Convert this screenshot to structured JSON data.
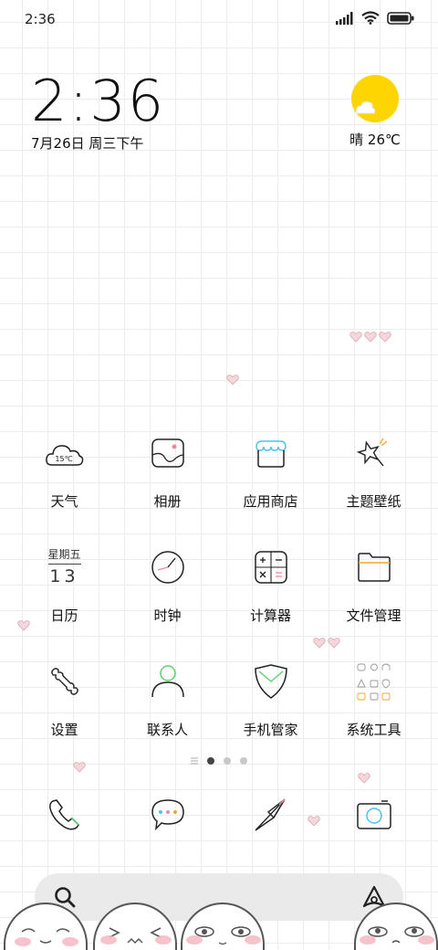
{
  "status_bar": {
    "time": "2:36",
    "icons": [
      "signal-icon",
      "wifi-icon",
      "battery-icon"
    ]
  },
  "clock_widget": {
    "time": "2:36",
    "date": "7月26日 周三下午"
  },
  "weather_widget": {
    "condition_icon": "sun-cloud-icon",
    "text": "晴 26℃"
  },
  "weather_app_icon_temp": "15℃",
  "calendar_icon": {
    "weekday": "星期五",
    "day": "13"
  },
  "apps": [
    {
      "label": "天气",
      "icon": "weather-icon"
    },
    {
      "label": "相册",
      "icon": "gallery-icon"
    },
    {
      "label": "应用商店",
      "icon": "app-store-icon"
    },
    {
      "label": "主题壁纸",
      "icon": "themes-icon"
    },
    {
      "label": "日历",
      "icon": "calendar-icon"
    },
    {
      "label": "时钟",
      "icon": "clock-icon"
    },
    {
      "label": "计算器",
      "icon": "calculator-icon"
    },
    {
      "label": "文件管理",
      "icon": "file-manager-icon"
    },
    {
      "label": "设置",
      "icon": "settings-icon"
    },
    {
      "label": "联系人",
      "icon": "contacts-icon"
    },
    {
      "label": "手机管家",
      "icon": "security-icon"
    },
    {
      "label": "系统工具",
      "icon": "system-tools-folder-icon"
    }
  ],
  "page_indicator": {
    "pages": 2,
    "current": 1
  },
  "dock": [
    {
      "icon": "phone-icon"
    },
    {
      "icon": "messages-icon"
    },
    {
      "icon": "browser-icon"
    },
    {
      "icon": "camera-icon"
    }
  ],
  "search_bar": {
    "left_icon": "search-icon",
    "right_icon": "assistant-icon"
  },
  "colors": {
    "sun": "#ffd500",
    "accent_pink": "#f08a9a",
    "accent_cyan": "#4cc3f0",
    "accent_green": "#5fcf6a",
    "accent_orange": "#f5a623"
  }
}
